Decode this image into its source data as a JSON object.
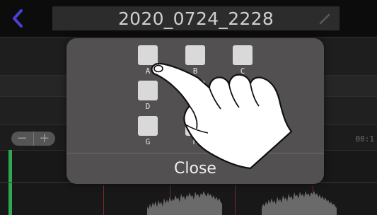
{
  "header": {
    "title": "2020_0724_2228",
    "back_icon": "chevron-left-icon",
    "edit_icon": "pencil-icon"
  },
  "zoom": {
    "minus_label": "−",
    "plus_label": "+"
  },
  "time_readout": "00:1",
  "marks_dialog": {
    "buttons": [
      {
        "label": "A",
        "visible": true
      },
      {
        "label": "B",
        "visible": true
      },
      {
        "label": "C",
        "visible": true
      },
      {
        "label": "D",
        "visible": true
      },
      {
        "label": "G",
        "visible": true
      },
      {
        "label": "H",
        "visible": true
      }
    ],
    "close_label": "Close"
  },
  "colors": {
    "accent_back": "#4b3fd6",
    "level_bar": "#2fa84f",
    "modal_bg": "#525050"
  }
}
